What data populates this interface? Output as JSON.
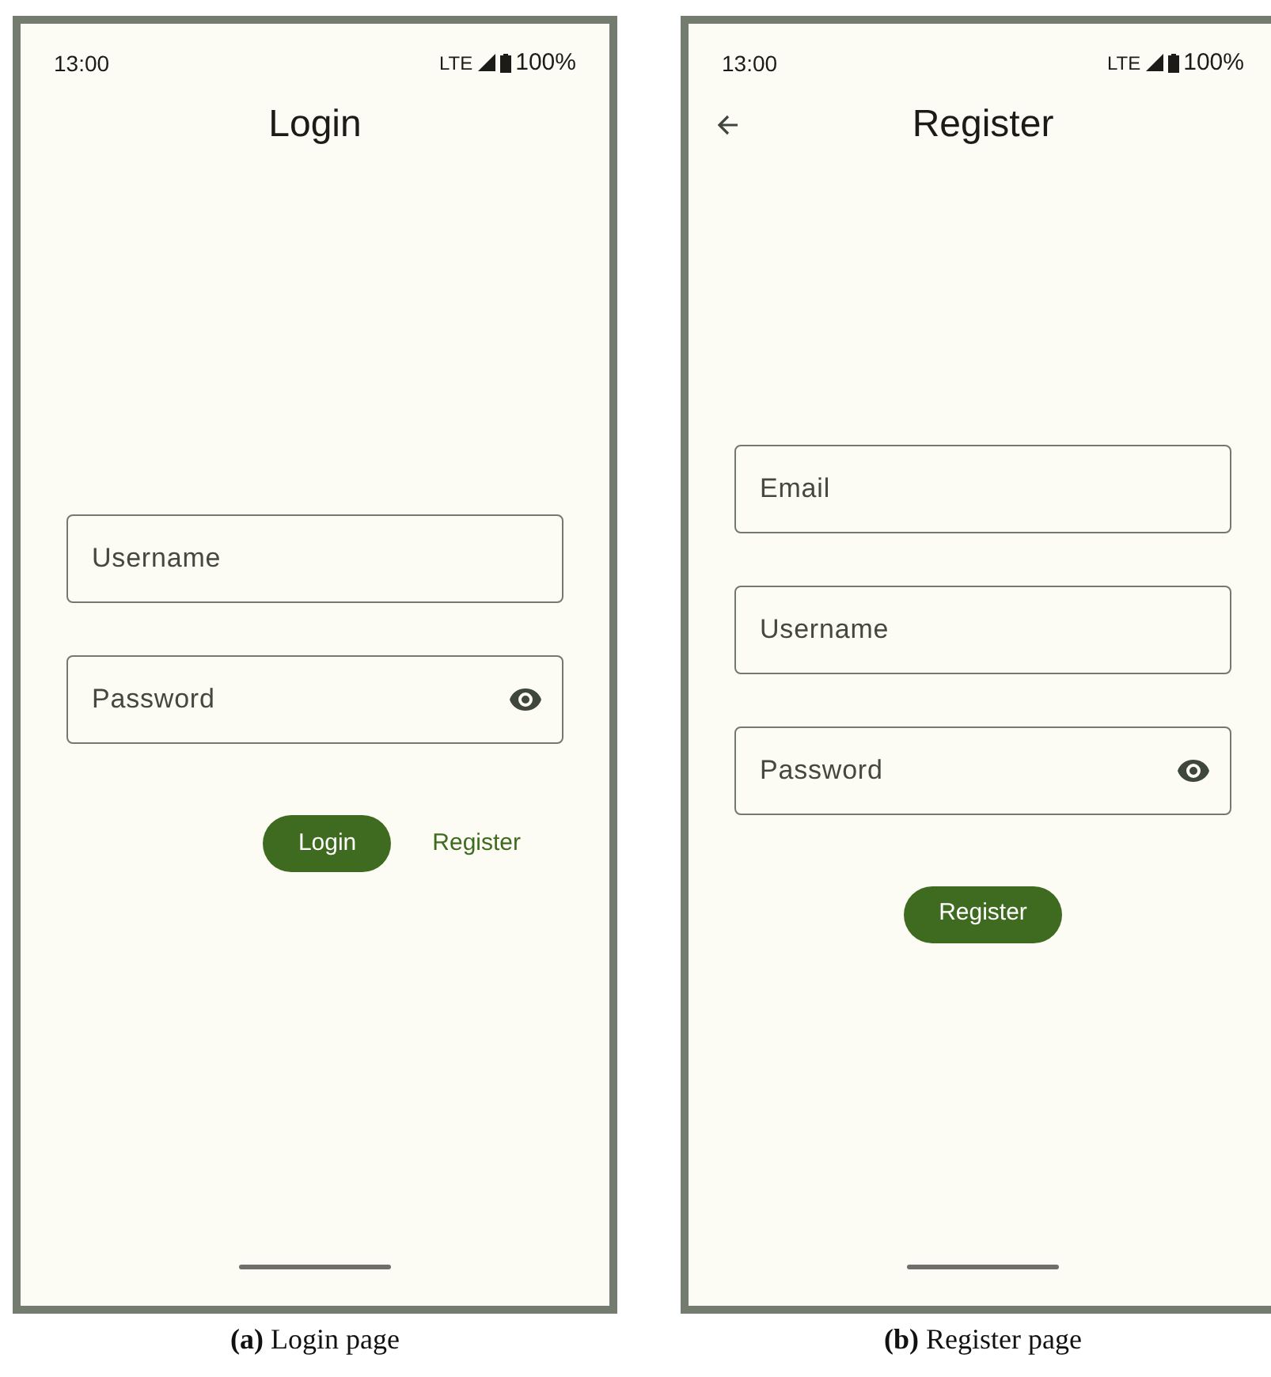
{
  "figures": [
    {
      "caption": "**(a)** Login page",
      "screen": {
        "status_time": "13:00",
        "network": "LTE",
        "battery": "100%",
        "title": "Login",
        "fields": [
          {
            "kind": "text",
            "placeholder": "Username"
          },
          {
            "kind": "password",
            "placeholder": "Password"
          }
        ],
        "actions": [
          {
            "kind": "filled",
            "label": "Login"
          },
          {
            "kind": "text",
            "label": "Register"
          }
        ]
      }
    },
    {
      "caption": "**(b)** Register page",
      "screen": {
        "status_time": "13:00",
        "network": "LTE",
        "battery": "100%",
        "nav_icon": {
          "kind": "back"
        },
        "title": "Register",
        "fields": [
          {
            "kind": "text",
            "placeholder": "Email"
          },
          {
            "kind": "text",
            "placeholder": "Username"
          },
          {
            "kind": "password",
            "placeholder": "Password"
          }
        ],
        "actions": [
          {
            "kind": "filled",
            "label": "Register"
          }
        ]
      }
    }
  ]
}
